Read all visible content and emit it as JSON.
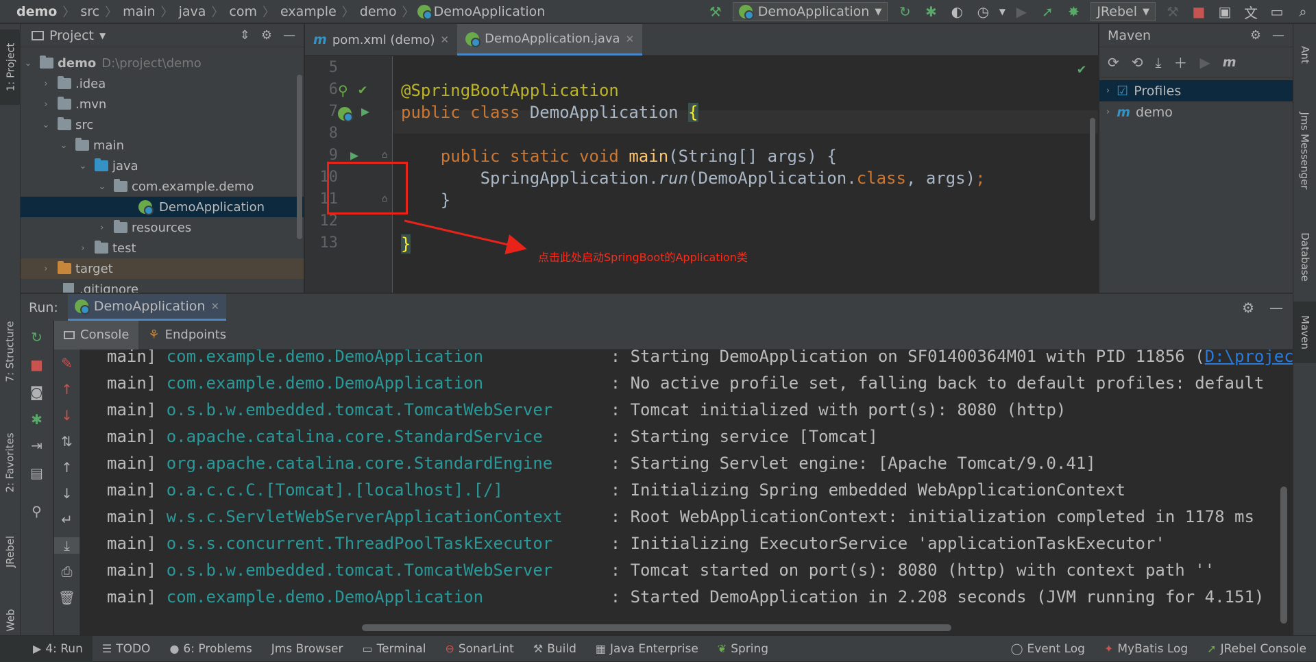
{
  "breadcrumbs": [
    "demo",
    "src",
    "main",
    "java",
    "com",
    "example",
    "demo",
    "DemoApplication"
  ],
  "toolbar": {
    "run_config": "DemoApplication",
    "jrebel": "JRebel"
  },
  "project_panel": {
    "title": "Project",
    "tree": [
      {
        "label": "demo",
        "path": "D:\\project\\demo"
      },
      {
        "label": ".idea"
      },
      {
        "label": ".mvn"
      },
      {
        "label": "src"
      },
      {
        "label": "main"
      },
      {
        "label": "java"
      },
      {
        "label": "com.example.demo"
      },
      {
        "label": "DemoApplication"
      },
      {
        "label": "resources"
      },
      {
        "label": "test"
      },
      {
        "label": "target"
      },
      {
        "label": ".gitignore"
      }
    ]
  },
  "editor": {
    "tabs": [
      {
        "label": "pom.xml (demo)"
      },
      {
        "label": "DemoApplication.java"
      }
    ],
    "line_numbers": [
      "5",
      "6",
      "7",
      "8",
      "9",
      "10",
      "11",
      "12",
      "13"
    ],
    "code": {
      "l6": "@SpringBootApplication",
      "l7_kw1": "public",
      "l7_kw2": "class",
      "l7_name": "DemoApplication",
      "l7_brace": "{",
      "l9_kw": "public static void",
      "l9_fn": "main",
      "l9_rest": "(String[] args) {",
      "l10_a": "SpringApplication.",
      "l10_b": "run",
      "l10_c": "(DemoApplication.",
      "l10_d": "class",
      "l10_e": ", args)",
      "l10_f": ";",
      "l11": "}",
      "l13": "}"
    },
    "annotation": "点击此处启动SpringBoot的Application类",
    "annotation_color": "#ff2a1a"
  },
  "maven_panel": {
    "title": "Maven",
    "items": [
      {
        "label": "Profiles"
      },
      {
        "label": "demo"
      }
    ]
  },
  "left_stripe": [
    "1: Project",
    "7: Structure",
    "2: Favorites",
    "JRebel",
    "Web"
  ],
  "right_stripe": [
    "Ant",
    "Jms Messenger",
    "Database",
    "Maven"
  ],
  "run_panel": {
    "label": "Run:",
    "tab": "DemoApplication",
    "console_tabs": [
      "Console",
      "Endpoints"
    ],
    "log": [
      {
        "thread": "main]",
        "logger": "com.example.demo.DemoApplication",
        "message": ": Starting DemoApplication on SF01400364M01 with PID 11856 (",
        "link": "D:\\projec"
      },
      {
        "thread": "main]",
        "logger": "com.example.demo.DemoApplication",
        "message": ": No active profile set, falling back to default profiles: default"
      },
      {
        "thread": "main]",
        "logger": "o.s.b.w.embedded.tomcat.TomcatWebServer",
        "message": ": Tomcat initialized with port(s): 8080 (http)"
      },
      {
        "thread": "main]",
        "logger": "o.apache.catalina.core.StandardService",
        "message": ": Starting service [Tomcat]"
      },
      {
        "thread": "main]",
        "logger": "org.apache.catalina.core.StandardEngine",
        "message": ": Starting Servlet engine: [Apache Tomcat/9.0.41]"
      },
      {
        "thread": "main]",
        "logger": "o.a.c.c.C.[Tomcat].[localhost].[/]",
        "message": ": Initializing Spring embedded WebApplicationContext"
      },
      {
        "thread": "main]",
        "logger": "w.s.c.ServletWebServerApplicationContext",
        "message": ": Root WebApplicationContext: initialization completed in 1178 ms"
      },
      {
        "thread": "main]",
        "logger": "o.s.s.concurrent.ThreadPoolTaskExecutor",
        "message": ": Initializing ExecutorService 'applicationTaskExecutor'"
      },
      {
        "thread": "main]",
        "logger": "o.s.b.w.embedded.tomcat.TomcatWebServer",
        "message": ": Tomcat started on port(s): 8080 (http) with context path ''"
      },
      {
        "thread": "main]",
        "logger": "com.example.demo.DemoApplication",
        "message": ": Started DemoApplication in 2.208 seconds (JVM running for 4.151)"
      }
    ]
  },
  "bottom_bar": {
    "left": [
      "4: Run",
      "TODO",
      "6: Problems",
      "Jms Browser",
      "Terminal",
      "SonarLint",
      "Build",
      "Java Enterprise",
      "Spring"
    ],
    "right": [
      "Event Log",
      "MyBatis Log",
      "JRebel Console"
    ]
  },
  "colors": {
    "accent": "#4a88c7",
    "run_green": "#59a869",
    "logger_teal": "#299999",
    "keyword_orange": "#cc7832",
    "annotation_yellow": "#bbb529"
  }
}
